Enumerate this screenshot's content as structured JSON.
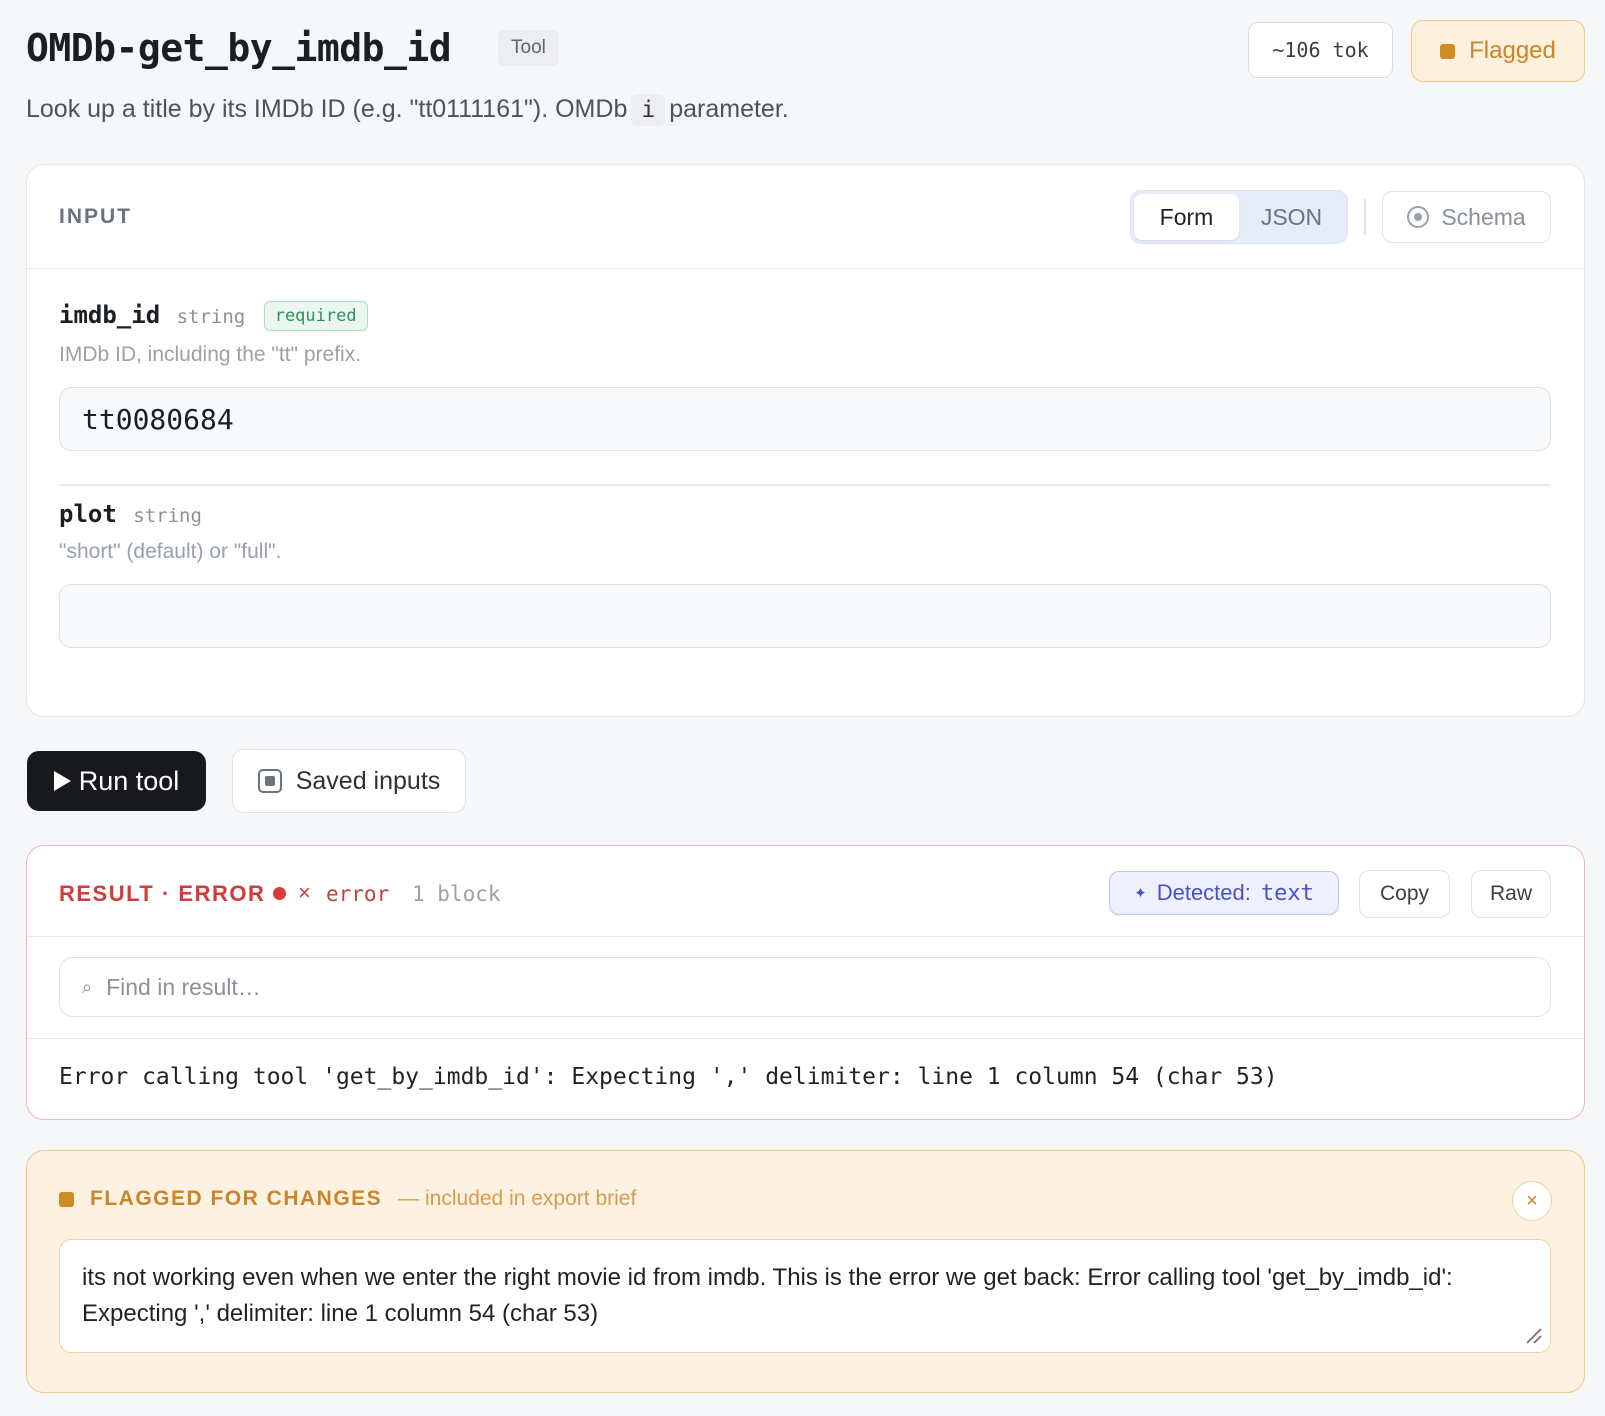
{
  "header": {
    "title": "OMDb-get_by_imdb_id",
    "tag": "Tool",
    "token_count": "~106 tok",
    "flag_label": "Flagged",
    "subtitle_before": "Look up a title by its IMDb ID (e.g. \"tt0111161\"). OMDb",
    "subtitle_code": "i",
    "subtitle_after": "parameter."
  },
  "input": {
    "section_label": "INPUT",
    "tabs": [
      {
        "label": "Form",
        "active": true
      },
      {
        "label": "JSON",
        "active": false
      }
    ],
    "schema_label": "Schema",
    "fields": [
      {
        "name": "imdb_id",
        "type": "string",
        "required_label": "required",
        "description": "IMDb ID, including the \"tt\" prefix.",
        "value": "tt0080684"
      },
      {
        "name": "plot",
        "type": "string",
        "description": "\"short\" (default) or \"full\".",
        "value": ""
      }
    ]
  },
  "actions": {
    "run_label": "Run tool",
    "saved_label": "Saved inputs"
  },
  "result": {
    "label": "RESULT · ERROR",
    "status_x": "×",
    "status_word": "error",
    "block_count": "1 block",
    "detected_prefix": "Detected:",
    "detected_value": "text",
    "copy_label": "Copy",
    "raw_label": "Raw",
    "search_placeholder": "Find in result…",
    "body": "Error calling tool 'get_by_imdb_id': Expecting ',' delimiter: line 1 column 54 (char 53)"
  },
  "flag": {
    "title": "FLAGGED FOR CHANGES",
    "subtitle": "— included in export brief",
    "close_glyph": "×",
    "note": "its not working even when we enter the right movie id from imdb. This is the error we get back: Error calling tool 'get_by_imdb_id': Expecting ',' delimiter: line 1 column 54 (char 53)"
  },
  "colors": {
    "accent_error": "#d03c3c",
    "accent_flag": "#c9852a",
    "accent_detected": "#4453c9",
    "required_green": "#2f8f5a"
  },
  "icons": {
    "flag": "square-icon",
    "schema": "target-circle-icon",
    "run": "play-icon",
    "saved": "bookmark-square-icon",
    "detected": "sparkle-icon",
    "search": "search-icon",
    "close": "close-icon"
  }
}
